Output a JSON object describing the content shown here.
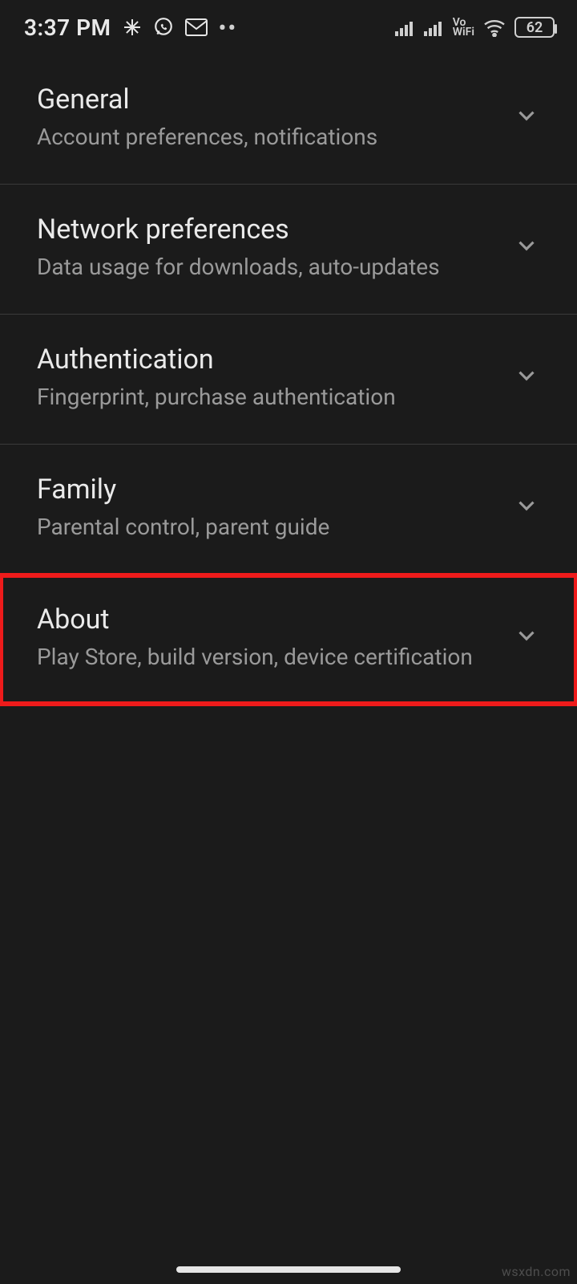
{
  "status_bar": {
    "time": "3:37 PM",
    "icons": [
      "slack",
      "whatsapp",
      "gmail",
      "more"
    ],
    "vowifi_label": "Vo\nWiFi",
    "battery": "62"
  },
  "settings": [
    {
      "key": "general",
      "title": "General",
      "desc": "Account preferences, notifications",
      "highlight": false
    },
    {
      "key": "network",
      "title": "Network preferences",
      "desc": "Data usage for downloads, auto-updates",
      "highlight": false
    },
    {
      "key": "auth",
      "title": "Authentication",
      "desc": "Fingerprint, purchase authentication",
      "highlight": false
    },
    {
      "key": "family",
      "title": "Family",
      "desc": "Parental control, parent guide",
      "highlight": false
    },
    {
      "key": "about",
      "title": "About",
      "desc": "Play Store, build version, device certification",
      "highlight": true
    }
  ],
  "watermark": "wsxdn.com"
}
